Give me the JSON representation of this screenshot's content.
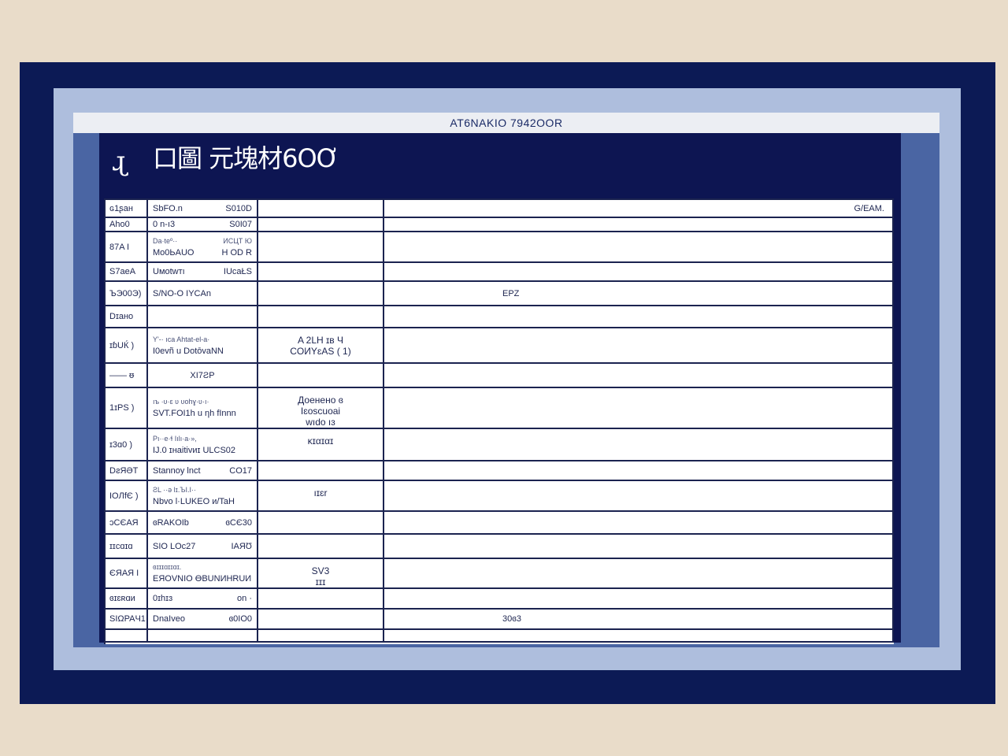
{
  "window": {
    "title": "AT6NAKIO 7942OOR"
  },
  "header": {
    "title": "口圖 元塊材6OƠ"
  },
  "table": {
    "rows": [
      {
        "label": "ԍ1ʂан",
        "c1a": "SbFO.n",
        "c1b": "S010D",
        "c2": "",
        "c3": "G/EAM.",
        "c3pos": "right"
      },
      {
        "label": "Aho0",
        "c1a": "0 n-ı3",
        "c1b": "S0I07",
        "c2": "",
        "c3": ""
      },
      {
        "label": "87A I",
        "c1a": "Mo0ЬAUO",
        "c1b": "H OD R",
        "c1sa": "Da·teº··",
        "c1sb": "ИСЦТ Ю",
        "c2": "",
        "c3": ""
      },
      {
        "label": "S7aeA",
        "c1a": "Uмotwтı",
        "c1b": "IUcaŁS",
        "c2": "",
        "c3": ""
      },
      {
        "label": "ЪЭ00Э)",
        "c1a": "S/NO-O IYCAn",
        "c1b": "",
        "c2": "",
        "c3": "EPZ",
        "c3pos": "center"
      },
      {
        "label": "Dɪaнo",
        "c1a": "",
        "c1b": "",
        "c2": "",
        "c3": ""
      },
      {
        "label": "ɪɓUЌ )",
        "c1a": "I0evñ u DotōvaNN",
        "c1b": "",
        "c1sa": "Y'-· ıca  Ahtat-el-a·",
        "c1sb": "",
        "c2": "A 2LH  ɪв Ч\nCOИYɛAS ( 1)",
        "c3": ""
      },
      {
        "label": "—— ᵿ",
        "c1a": "XI7ƧP",
        "c1b": "",
        "c2": "",
        "c3": ""
      },
      {
        "label": "1ɪPS )",
        "c1a": "SVT.FOI1h u ƞh fInnn",
        "c1b": "",
        "c1sa": "ıъ ·ʋ·ɛ ʋ ʋоhɣ·ʋ·ı·",
        "c1sb": "",
        "c2": "Доенено  ɞ\nIɛoscuoai\nwıdo ıɜ",
        "c3": ""
      },
      {
        "label": "ɪ3ɑ0  )",
        "c1a": "IJ.0 ɪнaitivиɪ ULCS02",
        "c1b": "",
        "c1sa": "Pı··e·ɬ Iılı·a·», ",
        "c1sb": "",
        "c2": "κɪαɪαɪ",
        "c3": ""
      },
      {
        "label": "DƨЯƏT",
        "c1a": "Stannoy lnct",
        "c1b": "СO17",
        "c2": "",
        "c3": ""
      },
      {
        "label": "IOЛfЄ )",
        "c1a": "Nbvo l·LUKEO ᴎ/TaH",
        "c1b": "",
        "c1sa": "ƧL  ··ə  lɪ.ЪI.I··",
        "c1sb": "",
        "c2": "ıɪɛr",
        "c3": ""
      },
      {
        "label": "ɔCЄAЯ",
        "c1a": "ɞRAKOIb",
        "c1b": "ɞCЄ30",
        "c2": "",
        "c3": ""
      },
      {
        "label": "ɪɪcɑɪɑ",
        "c1a": "SIO LOc27",
        "c1b": "IAЯƱ",
        "c2": "",
        "c3": ""
      },
      {
        "label": "ЄЯAЯ I",
        "c1a": "ЕЯOVNIO ƟBUNИHRUИ",
        "c1b": "",
        "c1sa": "ɞɪɪɪɑɪɪɑɪ.",
        "c1sb": "",
        "c2": "SV3\nɪɪɪ",
        "c3": ""
      },
      {
        "label": "ɞɪɛʀɑи",
        "c1a": "0ɪhɪɜ",
        "c1b": "on ·",
        "c2": "",
        "c3": ""
      },
      {
        "label": "SIΩPAЧ1",
        "c1a": "DnaIveo",
        "c1b": "ɞ0IO0",
        "c2": "",
        "c3": "30ɞ3",
        "c3pos": "center"
      },
      {
        "label": "",
        "c1a": "",
        "c1b": "",
        "c2": "",
        "c3": ""
      }
    ]
  }
}
